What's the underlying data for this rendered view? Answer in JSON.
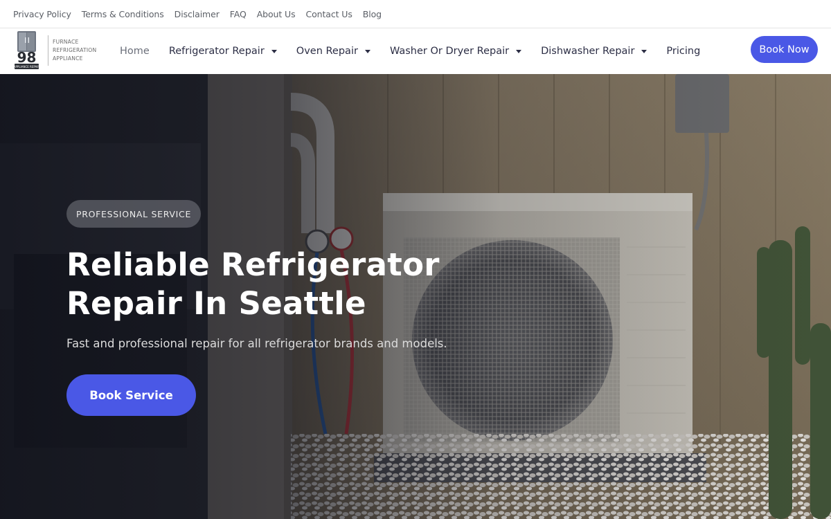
{
  "topbar": {
    "links": [
      "Privacy Policy",
      "Terms & Conditions",
      "Disclaimer",
      "FAQ",
      "About Us",
      "Contact Us",
      "Blog"
    ]
  },
  "logo": {
    "number": "98",
    "badge": "APPLIANCE REPAIR",
    "lines": [
      "FURNACE",
      "REFRIGERATION",
      "APPLIANCE"
    ]
  },
  "nav": {
    "items": [
      {
        "label": "Home",
        "dropdown": false
      },
      {
        "label": "Refrigerator Repair",
        "dropdown": true
      },
      {
        "label": "Oven Repair",
        "dropdown": true
      },
      {
        "label": "Washer Or Dryer Repair",
        "dropdown": true
      },
      {
        "label": "Dishwasher Repair",
        "dropdown": true
      },
      {
        "label": "Pricing",
        "dropdown": false
      }
    ],
    "cta": "Book Now"
  },
  "hero": {
    "badge": "PROFESSIONAL SERVICE",
    "title_line1": "Reliable Refrigerator",
    "title_line2": "Repair In Seattle",
    "subtitle": "Fast and professional repair for all refrigerator brands and models.",
    "cta": "Book Service"
  },
  "colors": {
    "accent": "#4a58e6",
    "nav_text": "#2c2e45",
    "topbar_text": "#5b5f66"
  }
}
